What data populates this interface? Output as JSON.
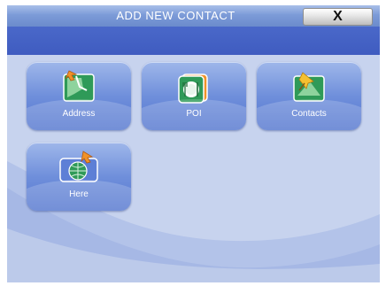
{
  "header": {
    "title": "ADD NEW CONTACT",
    "close_label": "X"
  },
  "tiles": [
    {
      "label": "Address",
      "icon": "address-map-icon"
    },
    {
      "label": "POI",
      "icon": "poi-restaurant-icon"
    },
    {
      "label": "Contacts",
      "icon": "contacts-pin-icon"
    },
    {
      "label": "Here",
      "icon": "here-globe-icon"
    }
  ],
  "colors": {
    "title_bar": "#7c9bd8",
    "blue_bar": "#4468c8",
    "background": "#c7d3ee",
    "tile": "#6f8fdb",
    "arrow_orange": "#f0922a"
  }
}
